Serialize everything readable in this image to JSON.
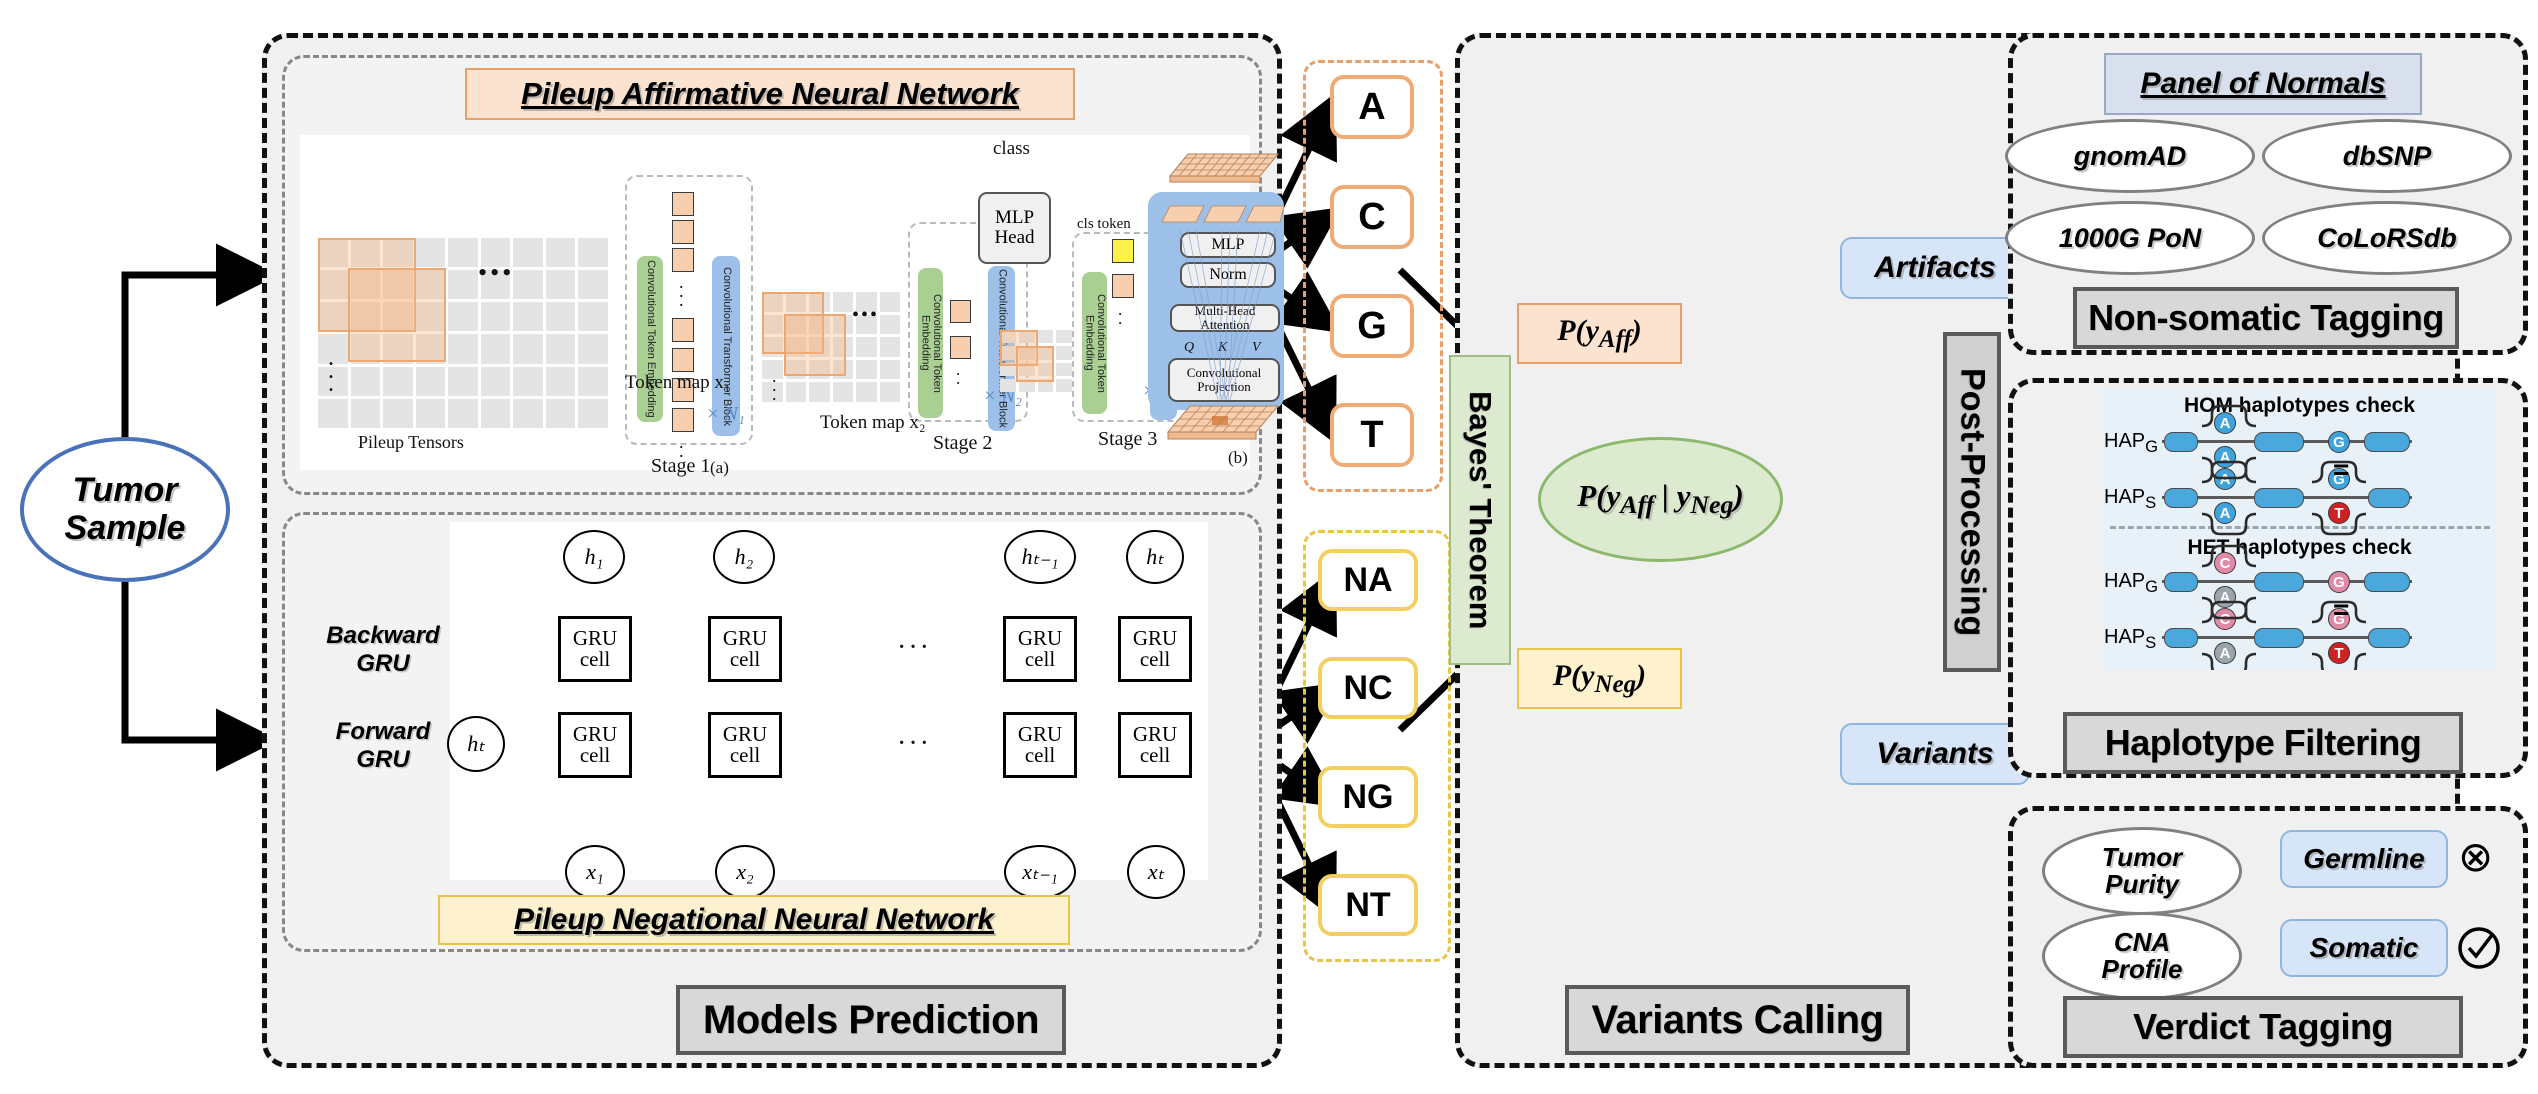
{
  "input": {
    "label": "Tumor\nSample",
    "label_line1": "Tumor",
    "label_line2": "Sample"
  },
  "sections": {
    "models_prediction": "Models Prediction",
    "variants_calling": "Variants Calling",
    "non_somatic_tagging": "Non-somatic Tagging",
    "haplotype_filtering": "Haplotype Filtering",
    "verdict_tagging": "Verdict Tagging"
  },
  "affirmative": {
    "title": "Pileup Affirmative Neural Network",
    "tensor_label": "Pileup Tensors",
    "stages": [
      "Stage 1",
      "Stage 2",
      "Stage 3"
    ],
    "token_maps": [
      "Token map x₁",
      "Token map x₂"
    ],
    "repeats": [
      "× N₁",
      "× N₂",
      "× N₃"
    ],
    "embedding_label": "Convolutional Token Embedding",
    "block_label": "Convolutional Transformer Block",
    "cls_token": "cls token",
    "class_label": "class",
    "mlp_head": "MLP Head",
    "subfig_a": "(a)",
    "subfig_b": "(b)",
    "detail": {
      "mlp": "MLP",
      "norm": "Norm",
      "attention": "Multi-Head Attention",
      "projection": "Convolutional Projection",
      "qkv": [
        "Q",
        "K",
        "V"
      ]
    }
  },
  "negational": {
    "title": "Pileup Negational Neural Network",
    "backward_label": "Backward\nGRU",
    "backward_line1": "Backward",
    "backward_line2": "GRU",
    "forward_label": "Forward\nGRU",
    "forward_line1": "Forward",
    "forward_line2": "GRU",
    "cell_label_line1": "GRU",
    "cell_label_line2": "cell",
    "hidden_outputs": [
      "h₁",
      "h₂",
      "hₜ₋₁",
      "hₜ"
    ],
    "inputs": [
      "x₁",
      "x₂",
      "xₜ₋₁",
      "xₜ"
    ],
    "init_state": "hₜ",
    "ellipsis": "···"
  },
  "variants_calling": {
    "affirmative_bases": [
      "A",
      "C",
      "G",
      "T"
    ],
    "negational_bases": [
      "NA",
      "NC",
      "NG",
      "NT"
    ],
    "bayes_label": "Bayes' Theorem",
    "prob_aff": "P(y_Aff)",
    "prob_neg": "P(y_Neg)",
    "posterior": "P(y_Aff | y_Neg)",
    "outputs": [
      "Artifacts",
      "Variants"
    ],
    "post_processing_label": "Post-Processing"
  },
  "panel_of_normals": {
    "title": "Panel of Normals",
    "databases": [
      "gnomAD",
      "dbSNP",
      "1000G PoN",
      "CoLoRSdb"
    ]
  },
  "haplotypes": {
    "hom_title": "HOM haplotypes check",
    "het_title": "HET haplotypes check",
    "row_labels": [
      "HAP",
      "HAP"
    ],
    "hap_g": "HAP",
    "hap_g_sub": "G",
    "hap_s": "HAP",
    "hap_s_sub": "S",
    "equals": "=",
    "hom": {
      "hap_g": {
        "pair1": [
          "A",
          "A"
        ],
        "single": "G"
      },
      "hap_s": {
        "pair1": [
          "A",
          "A"
        ],
        "pair2": [
          "G",
          "T"
        ]
      }
    },
    "het": {
      "hap_g": {
        "pair1": [
          "C",
          "A"
        ],
        "single": "G"
      },
      "hap_s": {
        "pair1": [
          "C",
          "A"
        ],
        "pair2": [
          "G",
          "T"
        ]
      }
    }
  },
  "verdict": {
    "factors": [
      "Tumor Purity",
      "CNA Profile"
    ],
    "factor1_line1": "Tumor",
    "factor1_line2": "Purity",
    "factor2_line1": "CNA",
    "factor2_line2": "Profile",
    "calls": [
      "Germline",
      "Somatic"
    ],
    "germline_mark": "⊗",
    "somatic_mark": "✓"
  },
  "colors": {
    "affirmative": "#fbe3d0",
    "affirmative_border": "#e8a06a",
    "negational": "#fdf2cd",
    "negational_border": "#e8c44a",
    "bayes": "#dcead0",
    "blue_box": "#d6e5f7",
    "plate": "#d8d8d8",
    "panel_bg": "#f0f0f0"
  }
}
